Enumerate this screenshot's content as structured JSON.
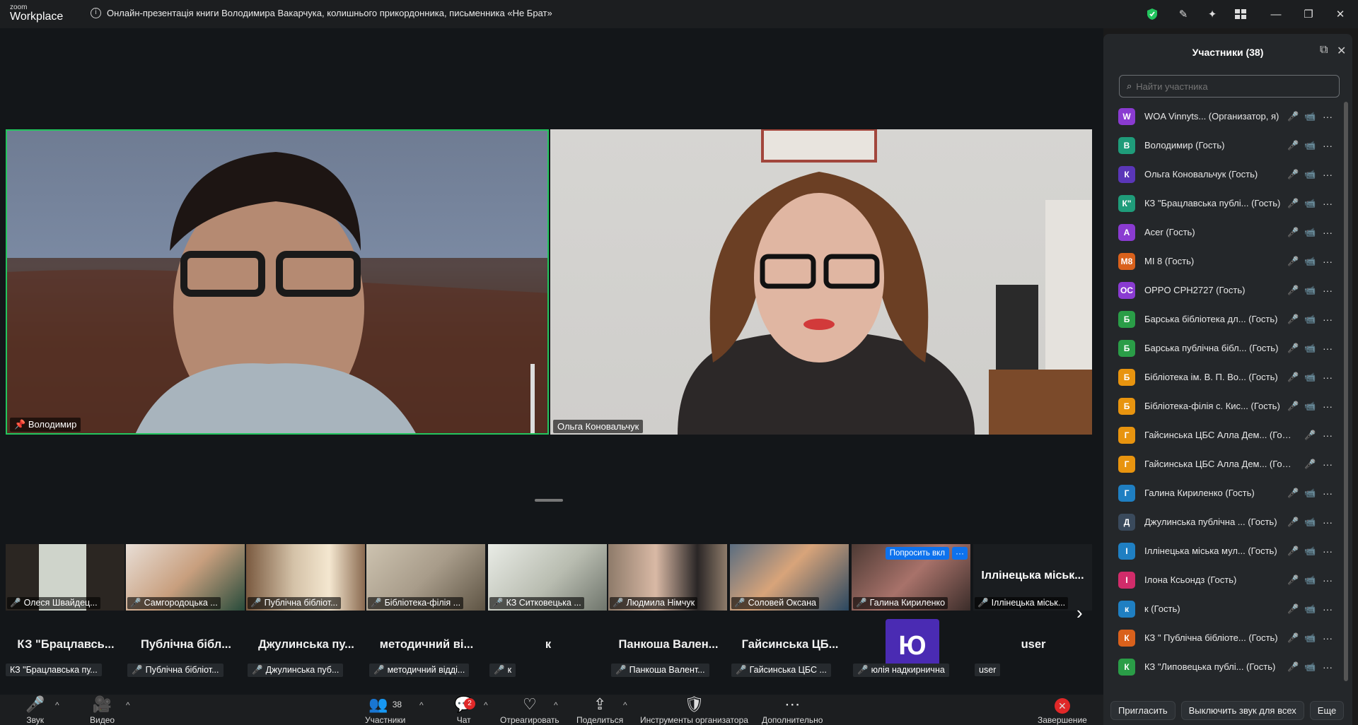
{
  "app": {
    "logo_top": "zoom",
    "logo_main": "Workplace"
  },
  "meeting": {
    "title": "Онлайн-презентація книги Володимира Вакарчука, колишнього прикордонника, письменника «Не Брат»"
  },
  "main_videos": [
    {
      "name": "Володимир",
      "pinned": true
    },
    {
      "name": "Ольга Коновальчук",
      "pinned": false
    }
  ],
  "thumbs": [
    {
      "label": "Олеся Швайдец..."
    },
    {
      "label": "Самгородоцька ..."
    },
    {
      "label": "Публічна бібліот..."
    },
    {
      "label": "Бібліотека-філія ..."
    },
    {
      "label": "КЗ Ситковецька ..."
    },
    {
      "label": "Людмила Німчук"
    },
    {
      "label": "Соловей Оксана"
    },
    {
      "label": "Галина Кириленко",
      "ask": "Попросить вкл",
      "dots": "···"
    },
    {
      "label": "Іллінецька міськ...",
      "big": "Іллінецька міськ..."
    }
  ],
  "bottom_row": [
    {
      "big": "КЗ \"Брацлавсь...",
      "label": "КЗ \"Брацлавська пу..."
    },
    {
      "big": "Публічна бібл...",
      "label": "Публічна бібліот..."
    },
    {
      "big": "Джулинська пу...",
      "label": "Джулинська пуб..."
    },
    {
      "big": "методичний ві...",
      "label": "методичний відді..."
    },
    {
      "big": "к",
      "label": "к"
    },
    {
      "big": "Панкоша Вален...",
      "label": "Панкоша Валент..."
    },
    {
      "big": "Гайсинська ЦБ...",
      "label": "Гайсинська ЦБС ..."
    },
    {
      "big": "Ю",
      "label": "юлія надкирнична"
    },
    {
      "big": "user",
      "label": "user"
    }
  ],
  "toolbar": {
    "audio": "Звук",
    "video": "Видео",
    "participants": "Участники",
    "participants_count": "38",
    "chat": "Чат",
    "chat_badge": "2",
    "react": "Отреагировать",
    "share": "Поделиться",
    "host_tools": "Инструменты организатора",
    "more": "Дополнительно",
    "end": "Завершение"
  },
  "panel": {
    "title": "Участники (38)",
    "search_placeholder": "Найти участника",
    "participants": [
      {
        "initials": "W",
        "color": "#8a3bd1",
        "name": "WOA Vinnyts... (Организатор, я)",
        "mic": "off",
        "cam": "off"
      },
      {
        "initials": "В",
        "color": "#1f9c7a",
        "name": "Володимир (Гость)",
        "mic": "on",
        "cam": "on"
      },
      {
        "initials": "К",
        "color": "#5a36b8",
        "name": "Ольга Коновальчук (Гость)",
        "mic": "on",
        "cam": "on"
      },
      {
        "initials": "К\"",
        "color": "#1f9c7a",
        "name": "КЗ \"Брацлавська публі... (Гость)",
        "mic": "on",
        "cam": "off"
      },
      {
        "initials": "A",
        "color": "#8a3bd1",
        "name": "Acer (Гость)",
        "mic": "off",
        "cam": "off"
      },
      {
        "initials": "M8",
        "color": "#d9611c",
        "name": "MI 8 (Гость)",
        "mic": "off",
        "cam": "off"
      },
      {
        "initials": "OC",
        "color": "#8a3bd1",
        "name": "OPPO CPH2727 (Гость)",
        "mic": "off",
        "cam": "off"
      },
      {
        "initials": "Б",
        "color": "#2a9d47",
        "name": "Барська бібліотека дл... (Гость)",
        "mic": "off",
        "cam": "off"
      },
      {
        "initials": "Б",
        "color": "#2a9d47",
        "name": "Барська публічна бібл... (Гость)",
        "mic": "off",
        "cam": "off"
      },
      {
        "initials": "Б",
        "color": "#e8940f",
        "name": "Бібліотека ім. В. П. Во... (Гость)",
        "mic": "off",
        "cam": "off"
      },
      {
        "initials": "Б",
        "color": "#e8940f",
        "name": "Бібліотека-філія с. Кис... (Гость)",
        "mic": "off",
        "cam": "on"
      },
      {
        "initials": "Г",
        "color": "#e8940f",
        "name": "Гайсинська ЦБС Алла Дем... (Гость)",
        "mic": "off",
        "cam": "none"
      },
      {
        "initials": "Г",
        "color": "#e8940f",
        "name": "Гайсинська ЦБС Алла Дем... (Гость)",
        "mic": "off",
        "cam": "none"
      },
      {
        "initials": "Г",
        "color": "#1f7fc2",
        "name": "Галина Кириленко (Гость)",
        "mic": "off",
        "cam": "on"
      },
      {
        "initials": "Д",
        "color": "#3a4a5c",
        "name": "Джулинська публічна ... (Гость)",
        "mic": "off",
        "cam": "off"
      },
      {
        "initials": "І",
        "color": "#1f7fc2",
        "name": "Іллінецька міська мул... (Гость)",
        "mic": "off",
        "cam": "off"
      },
      {
        "initials": "І",
        "color": "#d12c6a",
        "name": "Ілона Ксьондз (Гость)",
        "mic": "off",
        "cam": "off"
      },
      {
        "initials": "к",
        "color": "#1f7fc2",
        "name": "к (Гость)",
        "mic": "off",
        "cam": "off"
      },
      {
        "initials": "К",
        "color": "#d9611c",
        "name": "КЗ \" Публічна бібліоте... (Гость)",
        "mic": "off",
        "cam": "off"
      },
      {
        "initials": "К",
        "color": "#2a9d47",
        "name": "КЗ \"Липовецька публі... (Гость)",
        "mic": "off",
        "cam": "off"
      }
    ],
    "invite": "Пригласить",
    "mute_all": "Выключить звук для всех",
    "more": "Еще"
  },
  "icons": {
    "shield": "shield-icon",
    "pin": "pin-icon",
    "mic_off": "mic-off-icon"
  }
}
